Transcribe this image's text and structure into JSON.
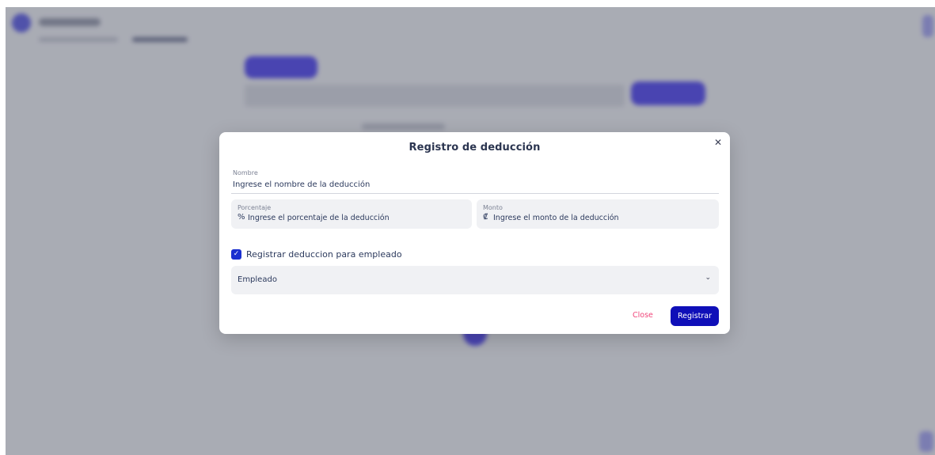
{
  "modal": {
    "title": "Registro de deducción",
    "close_icon": "close-icon",
    "nombre": {
      "label": "Nombre",
      "value": "Ingrese el nombre de la deducción"
    },
    "porcentaje": {
      "label": "Porcentaje",
      "prefix": "%",
      "value": "Ingrese el porcentaje de la deducción"
    },
    "monto": {
      "label": "Monto",
      "prefix": "₡",
      "value": "Ingrese el monto de la deducción"
    },
    "checkbox": {
      "label": "Registrar deduccion para empleado",
      "checked": true,
      "check_glyph": "✓"
    },
    "select": {
      "value": "Empleado",
      "chevron": "⌄"
    },
    "buttons": {
      "close_label": "Close",
      "submit_label": "Registrar"
    }
  },
  "colors": {
    "primary": "#0f0fb8",
    "checkbox": "#1a2fd0",
    "close_text": "#f0457a",
    "overlay": "#6c707d"
  }
}
